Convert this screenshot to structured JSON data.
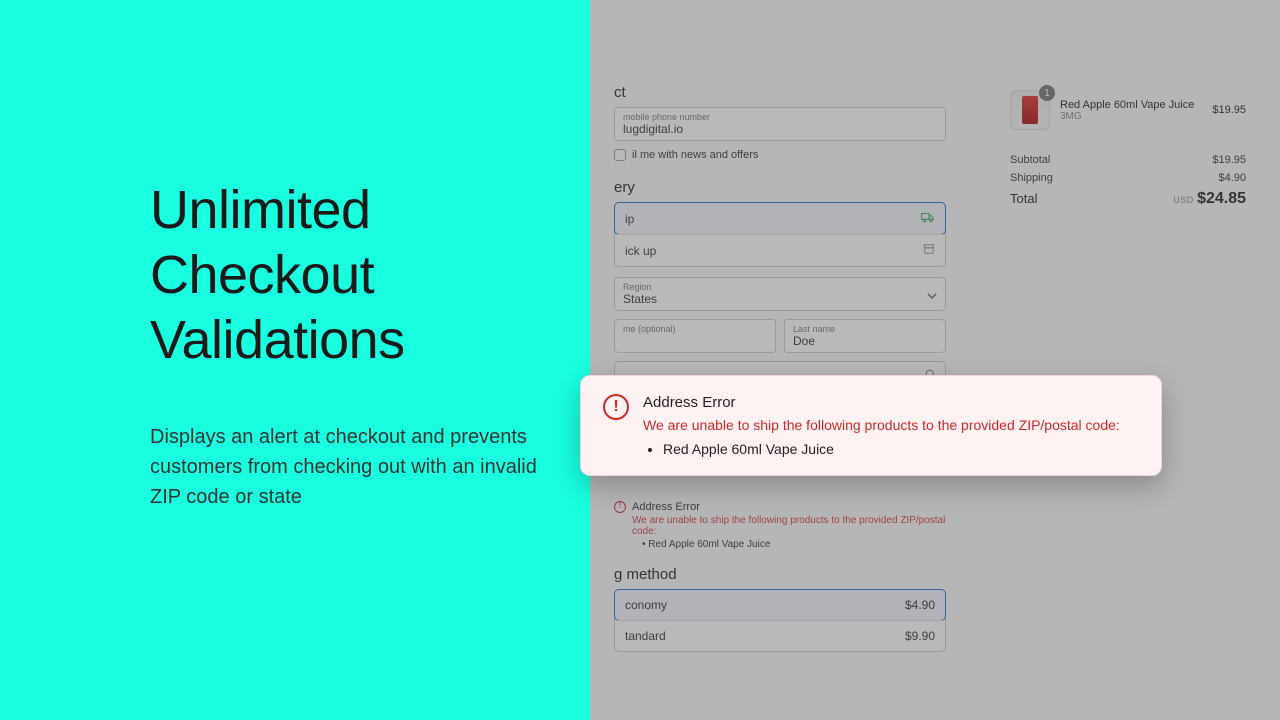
{
  "hero": {
    "headline_l1": "Unlimited",
    "headline_l2": "Checkout",
    "headline_l3": "Validations",
    "subcopy": "Displays an alert at checkout and prevents customers from checking out with an invalid ZIP code or state"
  },
  "checkout": {
    "contact_title_suffix": "ct",
    "email_label_suffix": "mobile phone number",
    "email_value_suffix": "lugdigital.io",
    "news_checkbox_suffix": "il me with news and offers",
    "delivery_title_suffix": "ery",
    "ship_label_suffix": "ip",
    "pickup_label_suffix": "ick up",
    "country_label_suffix": "Region",
    "country_value_suffix": "States",
    "first_label_suffix": "me (optional)",
    "last_label": "Last name",
    "last_value": "Doe",
    "inline_error_title": "Address Error",
    "inline_error_msg": "We are unable to ship the following products to the provided ZIP/postal code:",
    "inline_error_item": "Red Apple 60ml Vape Juice",
    "shipping_method_suffix": "g method",
    "economy_label_suffix": "conomy",
    "economy_price": "$4.90",
    "standard_label_suffix": "tandard",
    "standard_price": "$9.90"
  },
  "summary": {
    "product_name": "Red Apple 60ml Vape Juice",
    "variant": "3MG",
    "qty": "1",
    "price": "$19.95",
    "subtotal_label": "Subtotal",
    "subtotal": "$19.95",
    "shipping_label": "Shipping",
    "shipping": "$4.90",
    "total_label": "Total",
    "currency": "USD",
    "total": "$24.85"
  },
  "callout": {
    "title": "Address Error",
    "msg": "We are unable to ship the following products to the provided ZIP/postal code:",
    "item": "Red Apple 60ml Vape Juice"
  }
}
